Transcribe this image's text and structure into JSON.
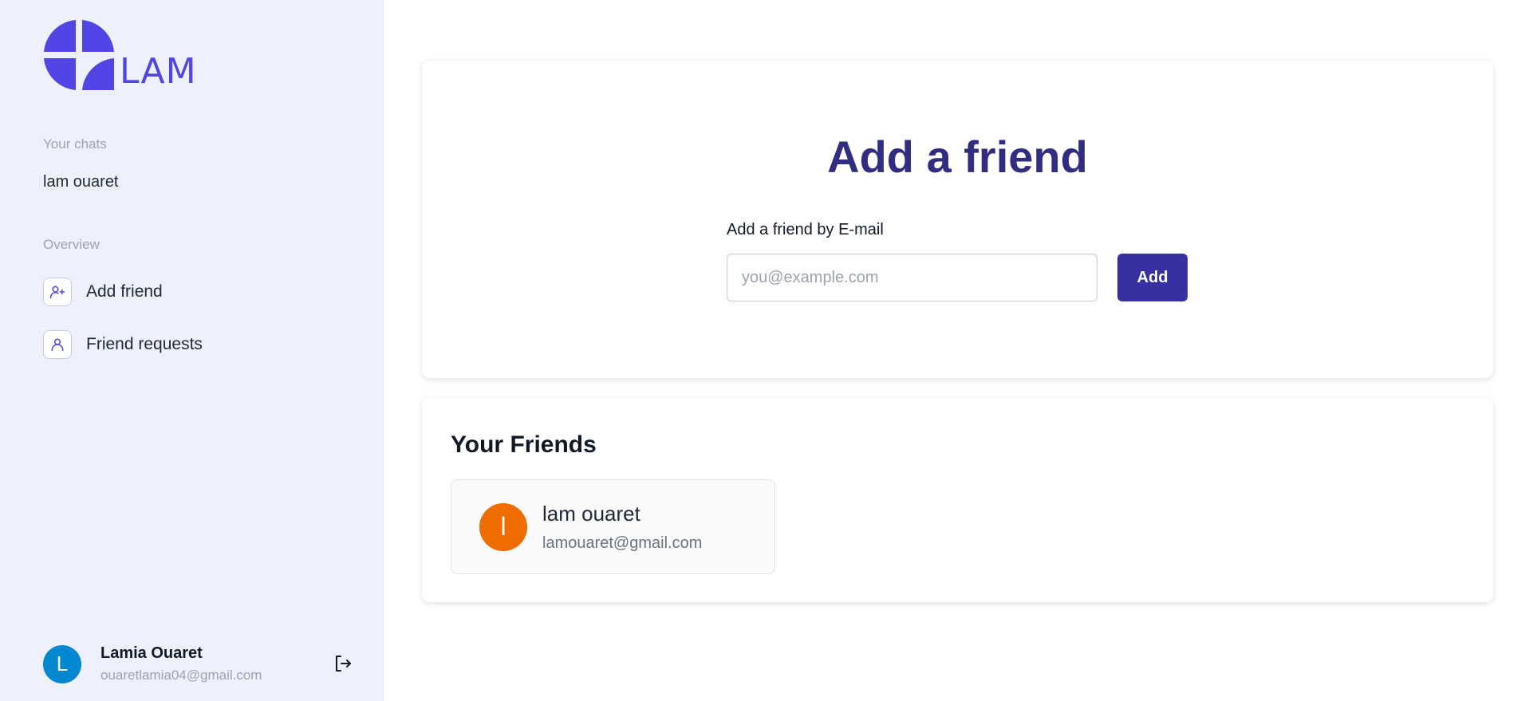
{
  "brand": {
    "name": "LAM",
    "color": "#5146e5"
  },
  "sidebar": {
    "chats_label": "Your chats",
    "chats": [
      "lam ouaret"
    ],
    "overview_label": "Overview",
    "nav": [
      {
        "label": "Add friend",
        "icon": "user-plus-icon"
      },
      {
        "label": "Friend requests",
        "icon": "user-icon"
      }
    ],
    "user": {
      "initial": "L",
      "name": "Lamia Ouaret",
      "email": "ouaretlamia04@gmail.com",
      "avatar_color": "#0288d1"
    },
    "logout_icon": "logout-icon"
  },
  "add_friend": {
    "title": "Add a friend",
    "field_label": "Add a friend by E-mail",
    "input_placeholder": "you@example.com",
    "input_value": "",
    "button_label": "Add",
    "accent": "#3730a3"
  },
  "friends": {
    "heading": "Your Friends",
    "items": [
      {
        "initial": "l",
        "name": "lam ouaret",
        "email": "lamouaret@gmail.com",
        "avatar_color": "#ef6c00"
      }
    ]
  }
}
